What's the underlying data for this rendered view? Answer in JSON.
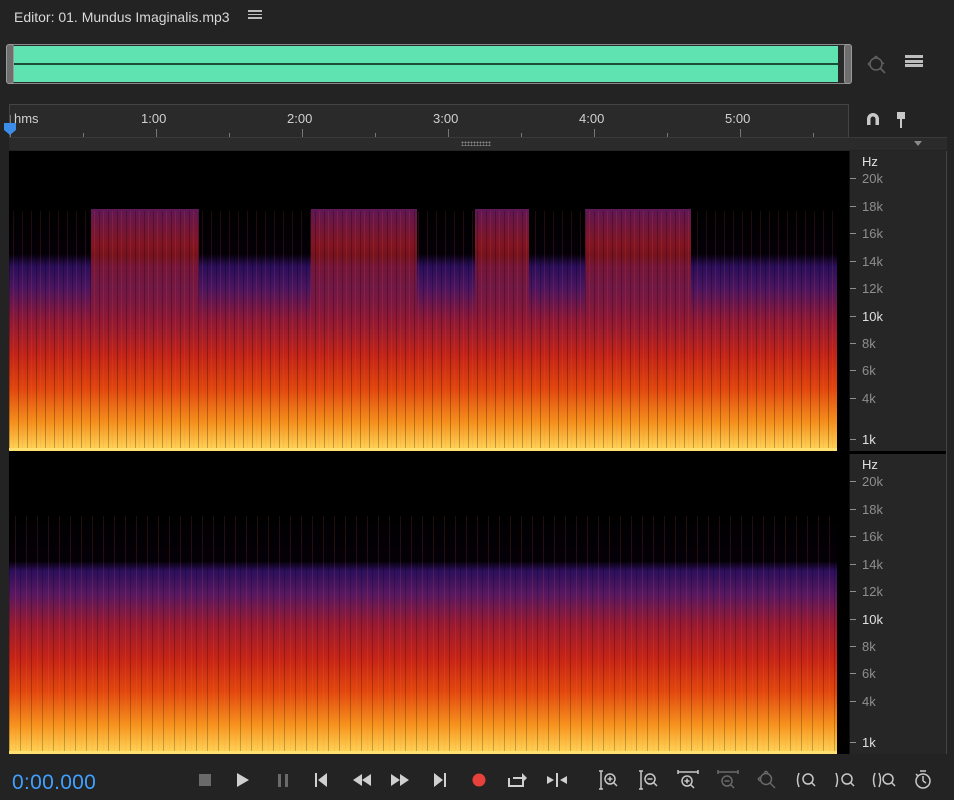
{
  "window": {
    "title": "Editor: 01. Mundus Imaginalis.mp3",
    "menu_icon": "hamburger-menu-icon"
  },
  "overview": {
    "waveform_color": "#5fe3b1",
    "icons": [
      "zoom-out-full-icon",
      "panel-layout-icon"
    ]
  },
  "timeline": {
    "unit_label": "hms",
    "ticks": [
      "1:00",
      "2:00",
      "3:00",
      "4:00",
      "5:00"
    ],
    "icons": [
      "snap-magnet-icon",
      "marker-pin-icon"
    ]
  },
  "frequency_scale": {
    "unit": "Hz",
    "labels": [
      "20k",
      "18k",
      "16k",
      "14k",
      "12k",
      "10k",
      "8k",
      "6k",
      "4k",
      "1k"
    ]
  },
  "channels": [
    {
      "name": "channel-left"
    },
    {
      "name": "channel-right"
    }
  ],
  "transport": {
    "current_time": "0:00.000",
    "record_color": "#e8413c",
    "time_color": "#3fa0ff",
    "buttons": [
      "stop-icon",
      "play-icon",
      "pause-icon",
      "go-to-start-icon",
      "rewind-icon",
      "fast-forward-icon",
      "go-to-end-icon",
      "record-icon",
      "loop-playback-icon",
      "skip-selection-icon"
    ],
    "zoom_buttons": [
      "zoom-in-amplitude-icon",
      "zoom-out-amplitude-icon",
      "zoom-in-time-icon",
      "zoom-out-time-icon",
      "zoom-out-full-icon",
      "zoom-in-selection-icon",
      "zoom-in-left-icon",
      "zoom-in-right-icon",
      "zoom-selection-icon"
    ]
  }
}
